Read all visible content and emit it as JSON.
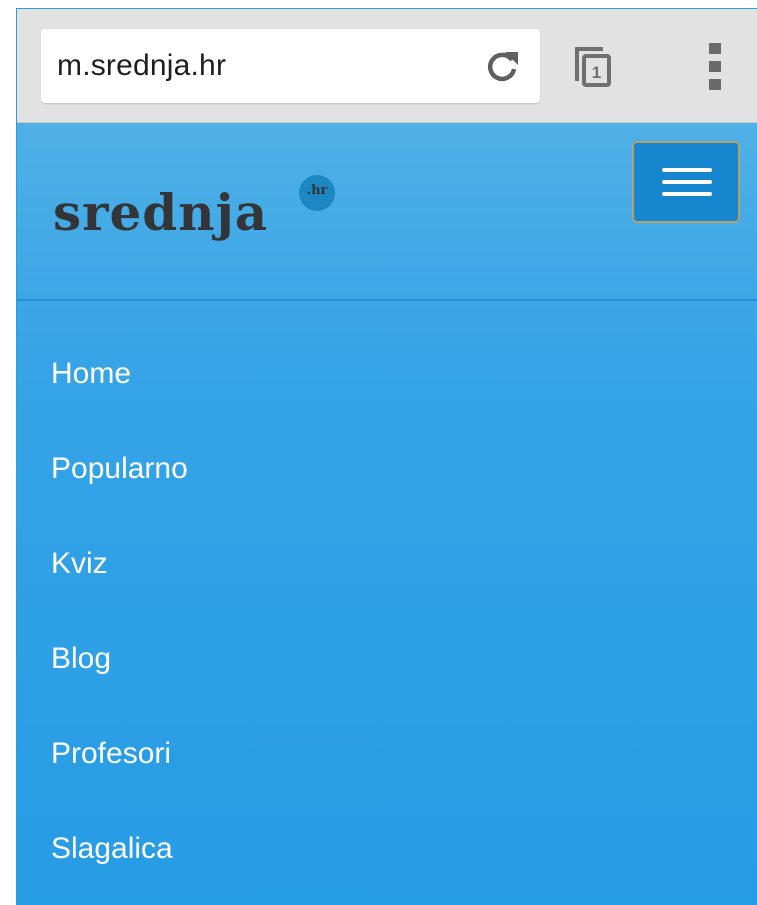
{
  "browser": {
    "url": "m.srednja.hr",
    "tab_count": "1",
    "icons": {
      "reload": "reload-icon",
      "tabs": "tabs-icon",
      "menu": "menu-dots-icon"
    }
  },
  "site": {
    "logo": {
      "text": "srednja",
      "badge": ".hr"
    },
    "menu_toggle": "hamburger-menu-icon",
    "nav": [
      {
        "label": "Home"
      },
      {
        "label": "Popularno"
      },
      {
        "label": "Kviz"
      },
      {
        "label": "Blog"
      },
      {
        "label": "Profesori"
      },
      {
        "label": "Slagalica"
      }
    ]
  },
  "colors": {
    "header_bg": "#4fb0e6",
    "nav_bg": "#269ce5",
    "toggle_bg": "#1687cf",
    "toggle_border": "#b6a064",
    "toolbar_bg": "#e2e2e2"
  }
}
